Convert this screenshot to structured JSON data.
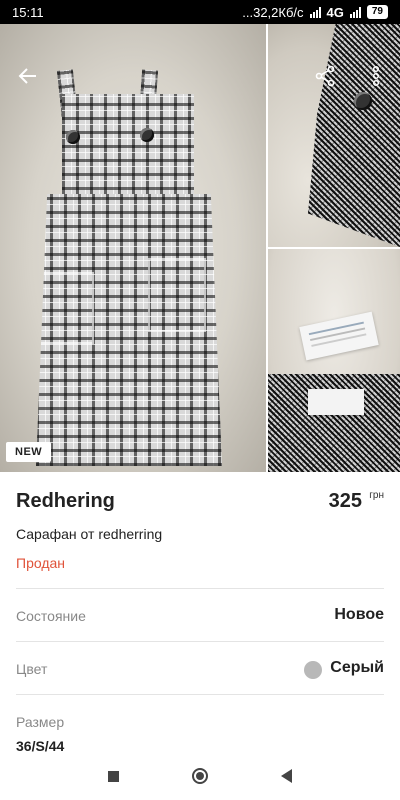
{
  "status_bar": {
    "time": "15:11",
    "network_speed": "...32,2Кб/с",
    "network_type": "4G",
    "battery": "79"
  },
  "gallery": {
    "badge": "NEW",
    "icons": {
      "back": "arrow-left-icon",
      "share": "share-icon",
      "more": "more-vertical-icon"
    }
  },
  "product": {
    "title": "Redhering",
    "price": "325",
    "currency": "грн",
    "subtitle": "Сарафан от redherring",
    "status": "Продан",
    "status_color": "#e0533a"
  },
  "attributes": {
    "condition": {
      "label": "Состояние",
      "value": "Новое"
    },
    "color": {
      "label": "Цвет",
      "value": "Серый",
      "swatch": "#b8b8b8"
    },
    "size": {
      "label": "Размер",
      "value": "36/S/44"
    }
  },
  "nav": {
    "icons": [
      "recents-square-icon",
      "home-circle-icon",
      "back-triangle-icon"
    ]
  }
}
